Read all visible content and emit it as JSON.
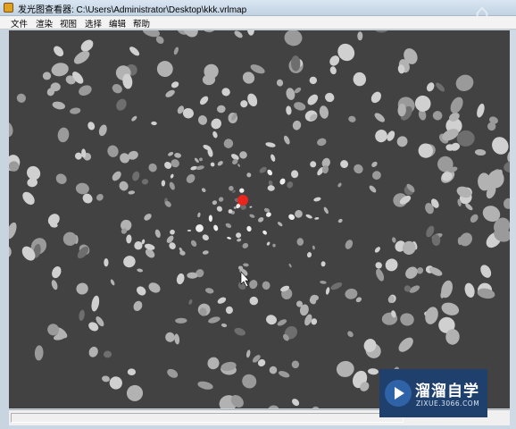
{
  "window": {
    "title": "发光图查看器: C:\\Users\\Administrator\\Desktop\\kkk.vrlmap"
  },
  "menu": {
    "items": [
      "文件",
      "渲染",
      "视图",
      "选择",
      "编辑",
      "帮助"
    ]
  },
  "viewport": {
    "background": "#424242",
    "marker_color": "#e8261e",
    "point_colors": [
      "#9a9a9a",
      "#b2b2b2",
      "#d0d0d0",
      "#ededed",
      "#6e6e6e"
    ]
  },
  "watermark": {
    "name": "溜溜自学",
    "url": "ZIXUE.3066.COM",
    "background": "#1f3f6d"
  },
  "top_watermark_icon": "logo-watermark-icon"
}
